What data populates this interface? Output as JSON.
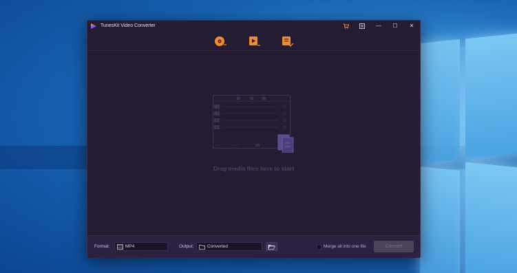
{
  "window": {
    "title": "TunesKit Video Converter",
    "controls": {
      "cart": "cart-icon",
      "menu": "menu-icon",
      "minimize": "—",
      "maximize": "☐",
      "close": "✕"
    }
  },
  "toolbar": {
    "tools": [
      "add-dvd-icon",
      "add-files-icon",
      "converted-icon"
    ],
    "accent": "#f08a2a"
  },
  "main": {
    "drop_hint": "Drag media files here to start"
  },
  "bottom": {
    "format_label": "Format:",
    "format_value": "MP4",
    "output_label": "Output:",
    "output_value": "Converted",
    "merge_label": "Merge all into one file",
    "merge_checked": false,
    "convert_label": "Convert"
  },
  "colors": {
    "app_bg": "#241c33",
    "bottom_bg": "#2a2240",
    "convert_disabled": "#4a4258"
  }
}
